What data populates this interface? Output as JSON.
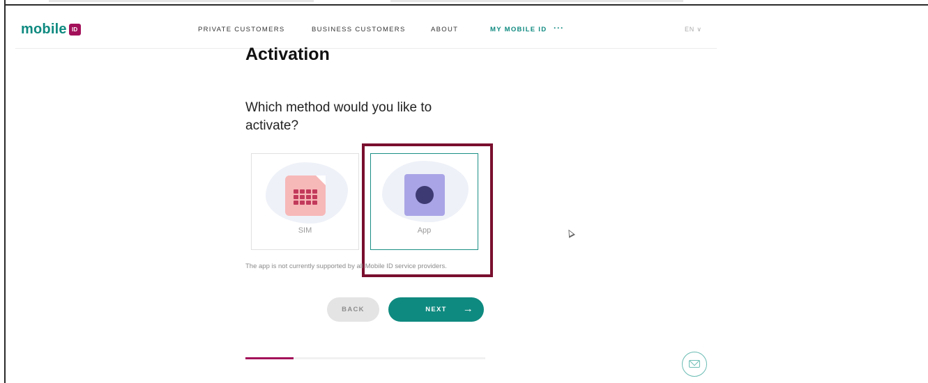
{
  "header": {
    "logo_text": "mobile",
    "logo_badge": "ID",
    "nav": [
      {
        "label": "PRIVATE CUSTOMERS"
      },
      {
        "label": "BUSINESS CUSTOMERS"
      },
      {
        "label": "ABOUT"
      },
      {
        "label": "MY MOBILE ID",
        "active": true
      }
    ],
    "more": "···",
    "language": "EN ∨"
  },
  "main": {
    "title": "Activation",
    "question": "Which method would you like to activate?",
    "options": [
      {
        "label": "SIM",
        "icon": "sim-card-icon",
        "selected": false
      },
      {
        "label": "App",
        "icon": "app-icon",
        "selected": true
      }
    ],
    "note": "The app is not currently supported by all Mobile ID service providers.",
    "back_label": "BACK",
    "next_label": "NEXT",
    "next_icon": "arrow-right-icon",
    "progress": 0.2
  },
  "colors": {
    "brand_teal": "#0f8a80",
    "brand_magenta": "#a3105a",
    "highlight_box": "#7a0f2e"
  },
  "fab": {
    "icon": "mail-icon"
  }
}
